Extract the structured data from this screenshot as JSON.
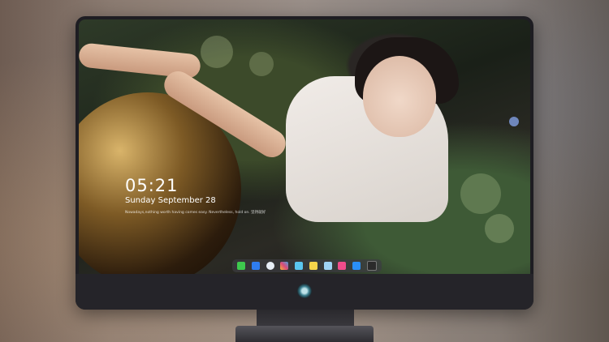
{
  "lock_screen": {
    "time": "05:21",
    "date": "Sunday September  28",
    "quote": "Nowadays,nothing worth having comes easy. Nevertheless, hold on. 坚持就好"
  },
  "dock": {
    "icons": [
      "messages-icon",
      "finder-icon",
      "safari-icon",
      "photos-icon",
      "launchpad-icon",
      "notes-icon",
      "preview-icon",
      "music-icon",
      "app-store-icon",
      "terminal-icon"
    ]
  },
  "colors": {
    "monitor_bezel": "#1e1d22",
    "dock_background": "#3c3c42"
  }
}
